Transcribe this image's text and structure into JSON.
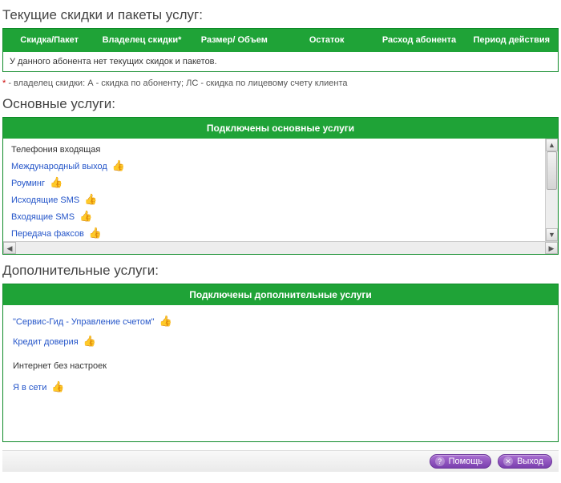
{
  "discounts": {
    "title": "Текущие скидки и пакеты услуг:",
    "columns": [
      "Скидка/Пакет",
      "Владелец скидки*",
      "Размер/ Объем",
      "Остаток",
      "Расход абонента",
      "Период действия"
    ],
    "empty_text": "У данного абонента нет текущих скидок и пакетов.",
    "footnote_star": "*",
    "footnote_text": " - владелец скидки: А - скидка по абоненту; ЛС - скидка по лицевому счету клиента"
  },
  "main_services": {
    "title": "Основные услуги:",
    "header": "Подключены основные услуги",
    "items": [
      {
        "label": "Телефония входящая",
        "link": false,
        "thumb": false
      },
      {
        "label": "Международный выход",
        "link": true,
        "thumb": true
      },
      {
        "label": "Роуминг",
        "link": true,
        "thumb": true
      },
      {
        "label": "Исходящие SMS",
        "link": true,
        "thumb": true
      },
      {
        "label": "Входящие SMS",
        "link": true,
        "thumb": true
      },
      {
        "label": "Передача факсов",
        "link": true,
        "thumb": true
      }
    ]
  },
  "additional_services": {
    "title": "Дополнительные услуги:",
    "header": "Подключены дополнительные услуги",
    "items": [
      {
        "label": "\"Сервис-Гид - Управление счетом\"",
        "link": true,
        "thumb": true
      },
      {
        "label": "Кредит доверия",
        "link": true,
        "thumb": true
      },
      {
        "label": "Интернет без настроек",
        "link": false,
        "thumb": false
      },
      {
        "label": "Я в сети",
        "link": true,
        "thumb": true
      }
    ]
  },
  "footer": {
    "help": "Помощь",
    "exit": "Выход"
  },
  "icons": {
    "thumb": "👍",
    "help": "?",
    "exit": "✕",
    "up": "▲",
    "down": "▼",
    "left": "◀",
    "right": "▶"
  }
}
